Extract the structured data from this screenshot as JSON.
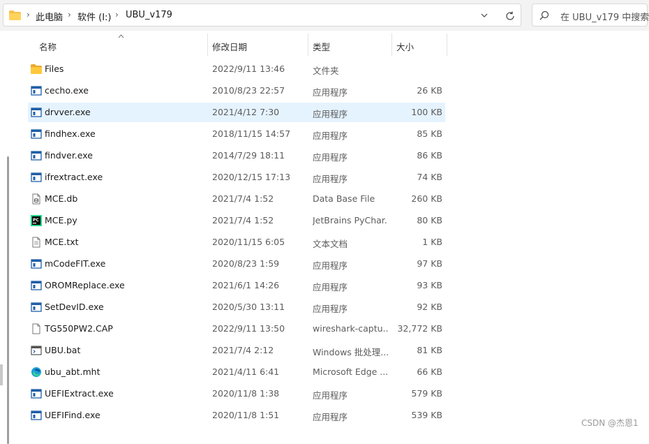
{
  "address_bar": {
    "breadcrumbs": [
      "此电脑",
      "软件 (I:)",
      "UBU_v179"
    ],
    "separator": ">"
  },
  "search": {
    "placeholder": "在 UBU_v179 中搜索"
  },
  "columns": {
    "name": "名称",
    "date": "修改日期",
    "type": "类型",
    "size": "大小"
  },
  "files": [
    {
      "name": "Files",
      "date": "2022/9/11 13:46",
      "type": "文件夹",
      "size": "",
      "icon": "folder-icon"
    },
    {
      "name": "cecho.exe",
      "date": "2010/8/23 22:57",
      "type": "应用程序",
      "size": "26 KB",
      "icon": "exe-icon"
    },
    {
      "name": "drvver.exe",
      "date": "2021/4/12 7:30",
      "type": "应用程序",
      "size": "100 KB",
      "icon": "exe-icon",
      "selected": true
    },
    {
      "name": "findhex.exe",
      "date": "2018/11/15 14:57",
      "type": "应用程序",
      "size": "85 KB",
      "icon": "exe-icon"
    },
    {
      "name": "findver.exe",
      "date": "2014/7/29 18:11",
      "type": "应用程序",
      "size": "86 KB",
      "icon": "exe-icon"
    },
    {
      "name": "ifrextract.exe",
      "date": "2020/12/15 17:13",
      "type": "应用程序",
      "size": "74 KB",
      "icon": "exe-icon"
    },
    {
      "name": "MCE.db",
      "date": "2021/7/4 1:52",
      "type": "Data Base File",
      "size": "260 KB",
      "icon": "db-file-icon"
    },
    {
      "name": "MCE.py",
      "date": "2021/7/4 1:52",
      "type": "JetBrains PyChar...",
      "size": "80 KB",
      "icon": "pycharm-icon"
    },
    {
      "name": "MCE.txt",
      "date": "2020/11/15 6:05",
      "type": "文本文档",
      "size": "1 KB",
      "icon": "text-file-icon"
    },
    {
      "name": "mCodeFIT.exe",
      "date": "2020/8/23 1:59",
      "type": "应用程序",
      "size": "97 KB",
      "icon": "exe-icon"
    },
    {
      "name": "OROMReplace.exe",
      "date": "2021/6/1 14:26",
      "type": "应用程序",
      "size": "93 KB",
      "icon": "exe-icon"
    },
    {
      "name": "SetDevID.exe",
      "date": "2020/5/30 13:11",
      "type": "应用程序",
      "size": "92 KB",
      "icon": "exe-icon"
    },
    {
      "name": "TG550PW2.CAP",
      "date": "2022/9/11 13:50",
      "type": "wireshark-captu...",
      "size": "32,772 KB",
      "icon": "blank-file-icon"
    },
    {
      "name": "UBU.bat",
      "date": "2021/7/4 2:12",
      "type": "Windows 批处理...",
      "size": "81 KB",
      "icon": "bat-icon"
    },
    {
      "name": "ubu_abt.mht",
      "date": "2021/4/11 6:41",
      "type": "Microsoft Edge ...",
      "size": "66 KB",
      "icon": "edge-icon"
    },
    {
      "name": "UEFIExtract.exe",
      "date": "2020/11/8 1:38",
      "type": "应用程序",
      "size": "579 KB",
      "icon": "exe-icon"
    },
    {
      "name": "UEFIFind.exe",
      "date": "2020/11/8 1:51",
      "type": "应用程序",
      "size": "539 KB",
      "icon": "exe-icon"
    }
  ],
  "watermark": "CSDN @杰恩1",
  "colors": {
    "selection": "#e5f3ff",
    "folder": "#f5c04a",
    "exe_blue": "#1f5fa8"
  }
}
